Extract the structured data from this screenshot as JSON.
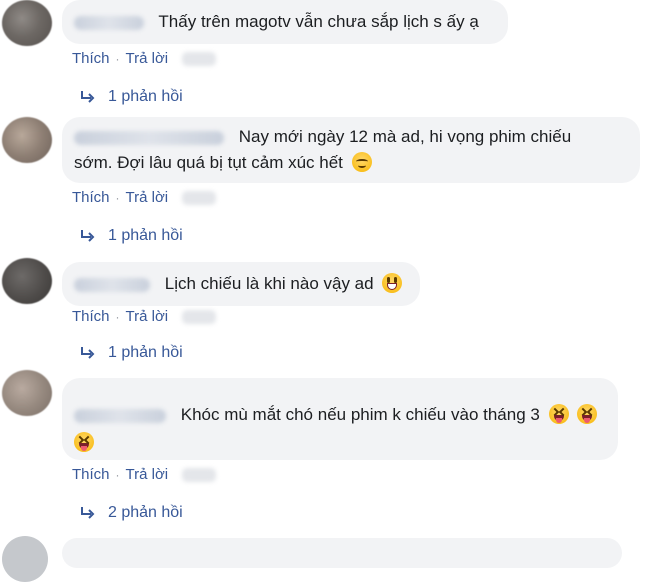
{
  "comments": [
    {
      "text": "Thấy trên magotv vẫn chưa sắp lịch s ấy ạ",
      "like_label": "Thích",
      "reply_label": "Trả lời",
      "replies_label": "1 phản hồi"
    },
    {
      "text_line1": "Nay mới ngày 12 mà ad, hi vọng phim chiếu",
      "text_line2": "sớm. Đợi lâu quá bị tụt cảm xúc hết",
      "emoji": "relieved-face-icon",
      "like_label": "Thích",
      "reply_label": "Trả lời",
      "replies_label": "1 phản hồi"
    },
    {
      "text": "Lịch chiếu là khi nào vậy ad",
      "emoji": "grinning-face-icon",
      "like_label": "Thích",
      "reply_label": "Trả lời",
      "replies_label": "1 phản hồi"
    },
    {
      "text": "Khóc mù mắt chó nếu phim k chiếu vào tháng 3",
      "emoji": "squinting-tongue-face-icon",
      "like_label": "Thích",
      "reply_label": "Trả lời",
      "replies_label": "2 phản hồi"
    }
  ],
  "colors": {
    "bubble": "#f2f3f5",
    "link": "#385898",
    "text": "#1c1e21"
  }
}
